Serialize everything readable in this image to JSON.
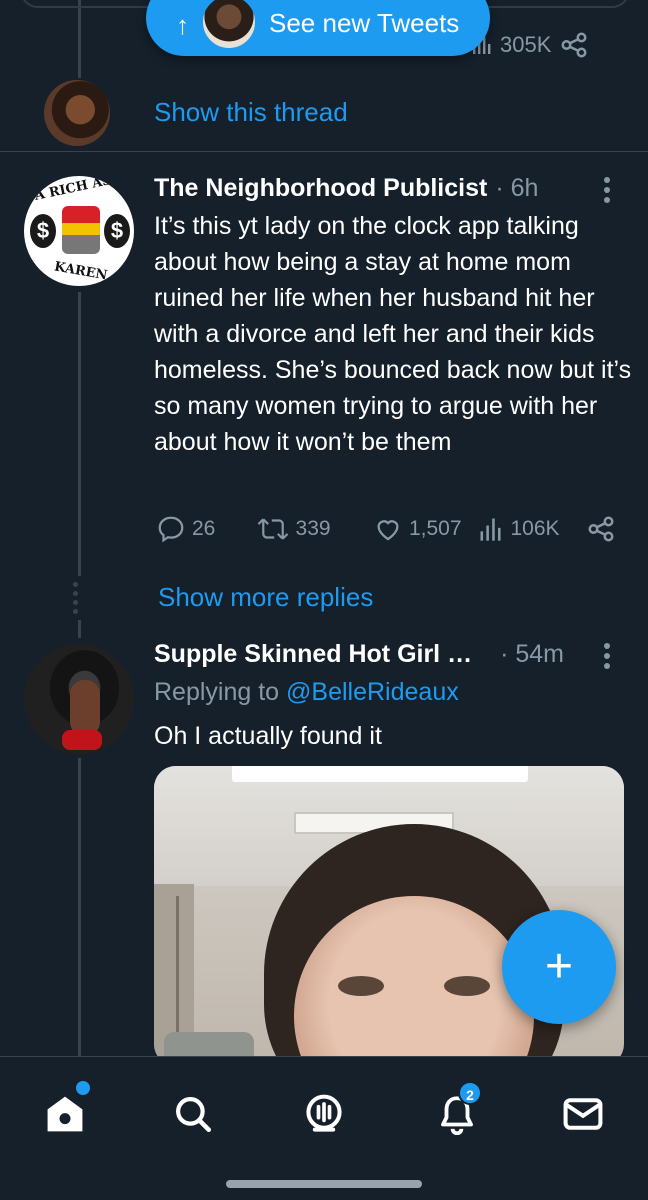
{
  "colors": {
    "background": "#15202b",
    "accent": "#1d9bf0",
    "muted": "#8899a6",
    "divider": "#38444d"
  },
  "top_tweet": {
    "views": "305K",
    "show_thread_label": "Show this thread",
    "views_icon": "views-icon",
    "share_icon": "share-icon"
  },
  "new_tweets_pill": {
    "label": "See new Tweets",
    "arrow_icon": "arrow-up-icon"
  },
  "tweet1": {
    "name": "The Neighborhood Publicist",
    "time": "· 6h",
    "avatar_text_top": "A RICH ASS",
    "avatar_text_bottom": "KAREN",
    "avatar_dollar": "$",
    "body": "It’s this yt lady on the clock app talking about how being a stay at home mom ruined her life when her husband hit her with a divorce and left her and their kids homeless. She’s bounced back now but it’s so many women trying to argue with her about how it won’t be them",
    "replies": "26",
    "retweets": "339",
    "likes": "1,507",
    "views": "106K"
  },
  "show_more_replies_label": "Show more replies",
  "tweet2": {
    "name": "Supple Skinned Hot Girl …",
    "time": "· 54m",
    "replying_prefix": "Replying to",
    "replying_handle": "@BelleRideaux",
    "body": "Oh I actually found it"
  },
  "fab": {
    "label": "+"
  },
  "bottom_nav": {
    "items": [
      {
        "icon": "home-icon",
        "active": true,
        "has_dot": true
      },
      {
        "icon": "search-icon"
      },
      {
        "icon": "spaces-icon"
      },
      {
        "icon": "notifications-icon",
        "badge": "2"
      },
      {
        "icon": "messages-icon"
      }
    ]
  }
}
